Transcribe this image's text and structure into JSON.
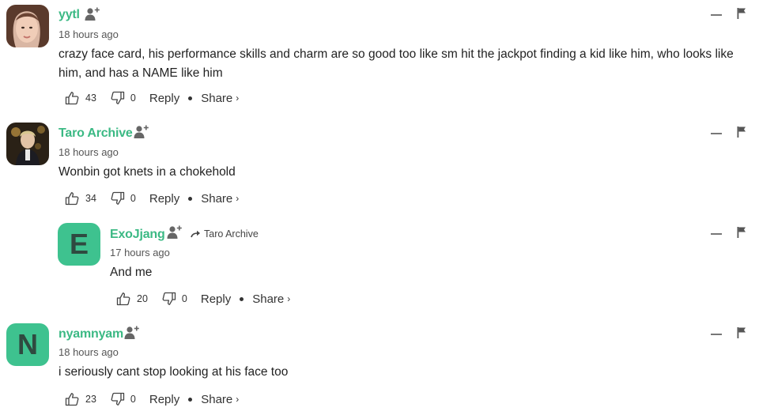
{
  "comments": [
    {
      "username": "yytl",
      "time": "18 hours ago",
      "text": "crazy face card, his performance skills and charm are so good too like sm hit the jackpot finding a kid like him, who looks like him, and has a NAME like him",
      "likes": "43",
      "dislikes": "0",
      "reply_label": "Reply",
      "share_label": "Share",
      "avatar": "photo"
    },
    {
      "username": "Taro Archive",
      "time": "18 hours ago",
      "text": "Wonbin got knets in a chokehold",
      "likes": "34",
      "dislikes": "0",
      "reply_label": "Reply",
      "share_label": "Share",
      "avatar": "photo"
    },
    {
      "username": "ExoJjang",
      "reply_to": "Taro Archive",
      "time": "17 hours ago",
      "text": "And me",
      "likes": "20",
      "dislikes": "0",
      "reply_label": "Reply",
      "share_label": "Share",
      "avatar_letter": "E"
    },
    {
      "username": "nyamnyam",
      "time": "18 hours ago",
      "text": "i seriously cant stop looking at his face too",
      "likes": "23",
      "dislikes": "0",
      "reply_label": "Reply",
      "share_label": "Share",
      "avatar_letter": "N"
    }
  ],
  "colors": {
    "username": "#3bb984",
    "letter_avatar_bg": "#3ec28f",
    "text": "#222222"
  },
  "icons": {
    "follow": "follow-user-icon",
    "like": "thumbs-up-icon",
    "dislike": "thumbs-down-icon",
    "minimize": "minimize-icon",
    "report": "flag-icon",
    "reply_arrow": "reply-arrow-icon",
    "share_chevron": "chevron-right-icon"
  }
}
